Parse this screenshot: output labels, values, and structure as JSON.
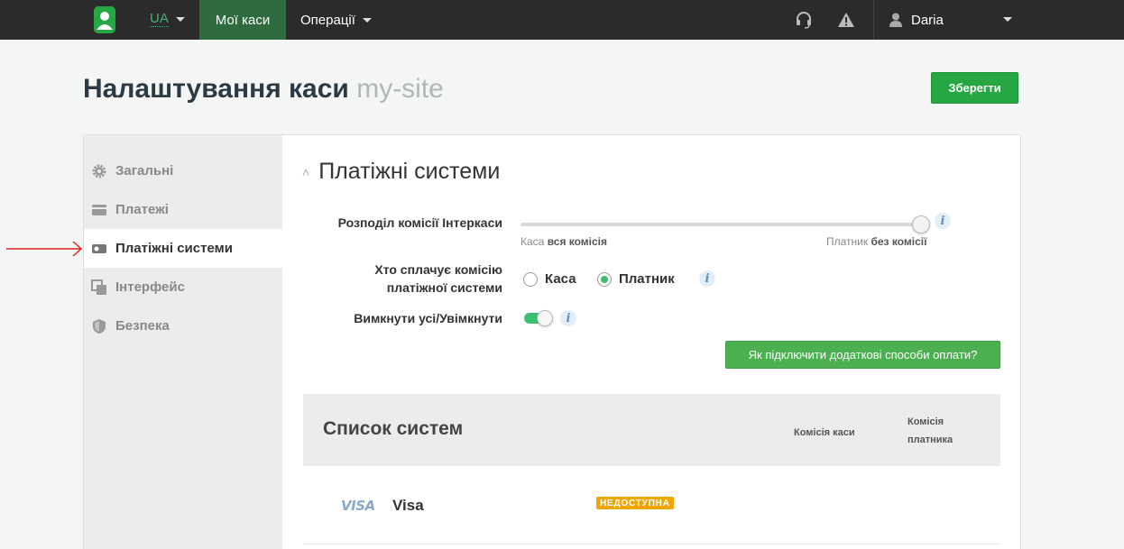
{
  "topbar": {
    "lang": "UA",
    "nav_active": "Мої каси",
    "nav_ops": "Операції",
    "user_name": "Daria",
    "icons": [
      "logo-icon",
      "headset-icon",
      "warning-icon",
      "user-icon"
    ]
  },
  "page": {
    "title_main": "Налаштування каси",
    "title_site": "my-site",
    "save_label": "Зберегти"
  },
  "sidebar": {
    "items": [
      {
        "label": "Загальні",
        "icon": "gear-icon"
      },
      {
        "label": "Платежі",
        "icon": "card-icon"
      },
      {
        "label": "Платіжні системи",
        "icon": "payment-system-icon",
        "active": true
      },
      {
        "label": "Інтерфейс",
        "icon": "interface-icon"
      },
      {
        "label": "Безпека",
        "icon": "shield-icon"
      }
    ]
  },
  "payment_systems": {
    "section_title": "Платіжні системи",
    "commission_split_label": "Розподіл комісії Інтеркаси",
    "commission_split_value": 1.0,
    "slider_left_a": "Каса",
    "slider_left_b": "вся комісія",
    "slider_right_a": "Платник",
    "slider_right_b": "без комісії",
    "who_pays_label_1": "Хто сплачує комісію",
    "who_pays_label_2": "платіжної системи",
    "radio_kasa": "Каса",
    "radio_payer": "Платник",
    "selected": "Платник",
    "toggle_all_label": "Вимкнути усі/Увімкнути",
    "toggle_all_on": true,
    "help_button": "Як підключити додаткові способи оплати?",
    "info_glyph": "i"
  },
  "system_list": {
    "title": "Список систем",
    "col_kasa": "Комісія каси",
    "col_payer_1": "Комісія",
    "col_payer_2": "платника",
    "rows": [
      {
        "logo": "VISA",
        "name": "Visa",
        "status": "НЕДОСТУПНА"
      }
    ]
  },
  "colors": {
    "topbar": "#2b2b2b",
    "active_nav": "#2e6b3f",
    "accent_green": "#27a744",
    "badge_orange": "#f0a500",
    "annotation_arrow": "#e02020"
  }
}
